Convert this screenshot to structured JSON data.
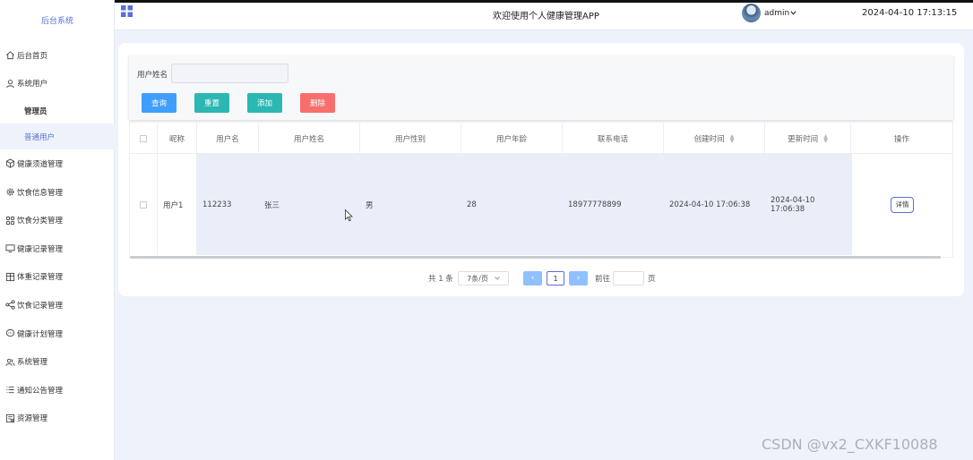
{
  "sidebar": {
    "brand": "后台系统",
    "items": [
      {
        "label": "后台首页",
        "icon": "home-icon"
      },
      {
        "label": "系统用户",
        "icon": "user-icon"
      },
      {
        "label": "健康须道管理",
        "icon": "cube-icon"
      },
      {
        "label": "饮食信息管理",
        "icon": "gear-icon"
      },
      {
        "label": "饮食分类管理",
        "icon": "grid-icon"
      },
      {
        "label": "健康记录管理",
        "icon": "monitor-icon"
      },
      {
        "label": "体重记录管理",
        "icon": "columns-icon"
      },
      {
        "label": "饮食记录管理",
        "icon": "share-icon"
      },
      {
        "label": "健康计划管理",
        "icon": "chat-icon"
      },
      {
        "label": "系统管理",
        "icon": "users-icon"
      },
      {
        "label": "通知公告管理",
        "icon": "list-icon"
      },
      {
        "label": "资源管理",
        "icon": "folder-icon"
      }
    ],
    "sub_items": [
      {
        "label": "管理员"
      },
      {
        "label": "普通用户"
      }
    ]
  },
  "header": {
    "title": "欢迎使用个人健康管理APP",
    "username": "admin",
    "datetime": "2024-04-10 17:13:15"
  },
  "search": {
    "label": "用户姓名",
    "value": "",
    "buttons": {
      "query": "查询",
      "reset": "重置",
      "add": "添加",
      "delete": "删除"
    }
  },
  "colors": {
    "accent": "#5b6fd8",
    "query": "#409eff",
    "reset": "#2bb7b3",
    "add": "#2bb7b3",
    "delete": "#f76f6c"
  },
  "table": {
    "columns": [
      "昵称",
      "用户名",
      "用户姓名",
      "用户性别",
      "用户年龄",
      "联系电话",
      "创建时间",
      "更新时间",
      "操作"
    ],
    "rows": [
      {
        "nickname": "用户1",
        "username": "112233",
        "realname": "张三",
        "gender": "男",
        "age": "28",
        "phone": "18977778899",
        "created": "2024-04-10 17:06:38",
        "updated": "2024-04-10 17:06:38",
        "action": "详情"
      }
    ]
  },
  "pagination": {
    "total": "共 1 条",
    "page_size": "7条/页",
    "current_page": "1",
    "goto_label": "前往",
    "page_unit": "页"
  },
  "watermark": "CSDN @vx2_CXKF10088"
}
